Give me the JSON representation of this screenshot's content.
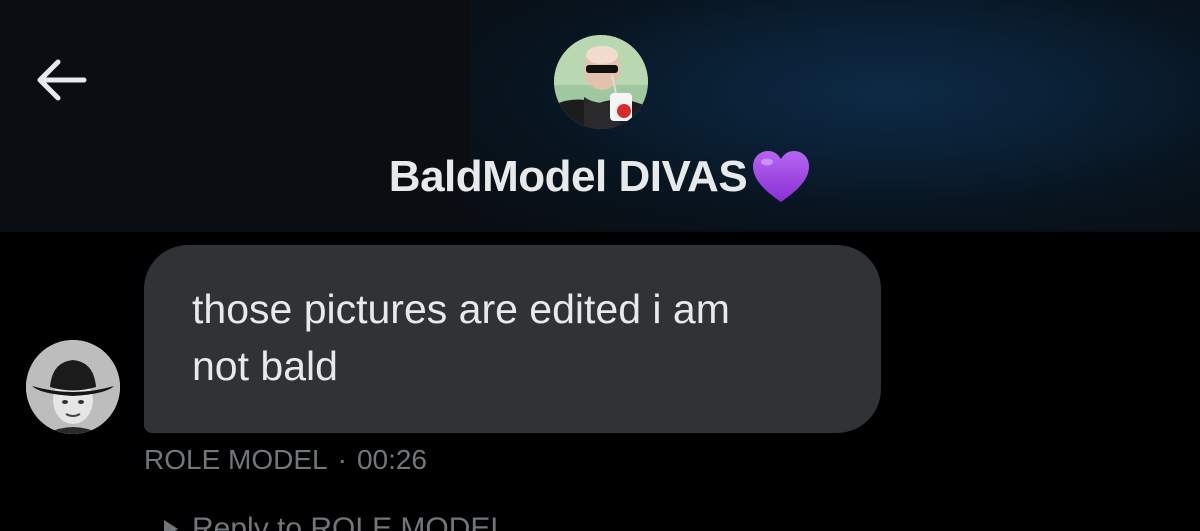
{
  "header": {
    "back_icon": "arrow-left-icon",
    "group_name": "BaldModel DIVAS",
    "emoji": "purple-heart-icon",
    "avatar_icon": "group-avatar-photo"
  },
  "message": {
    "text": "those pictures are edited i am\nnot bald",
    "sender": "ROLE MODEL",
    "separator": "·",
    "time": "00:26",
    "avatar_icon": "sender-avatar-cowboy-hat-photo"
  },
  "reply_hint": {
    "icon": "reply-arrow-icon",
    "label": "Reply to ROLE MODEL"
  },
  "colors": {
    "background": "#000000",
    "header_background": "#0a0d12",
    "bubble": "#2f3336",
    "text_primary": "#e7e9ea",
    "text_secondary": "#71767b",
    "heart": "#a64ce6"
  }
}
